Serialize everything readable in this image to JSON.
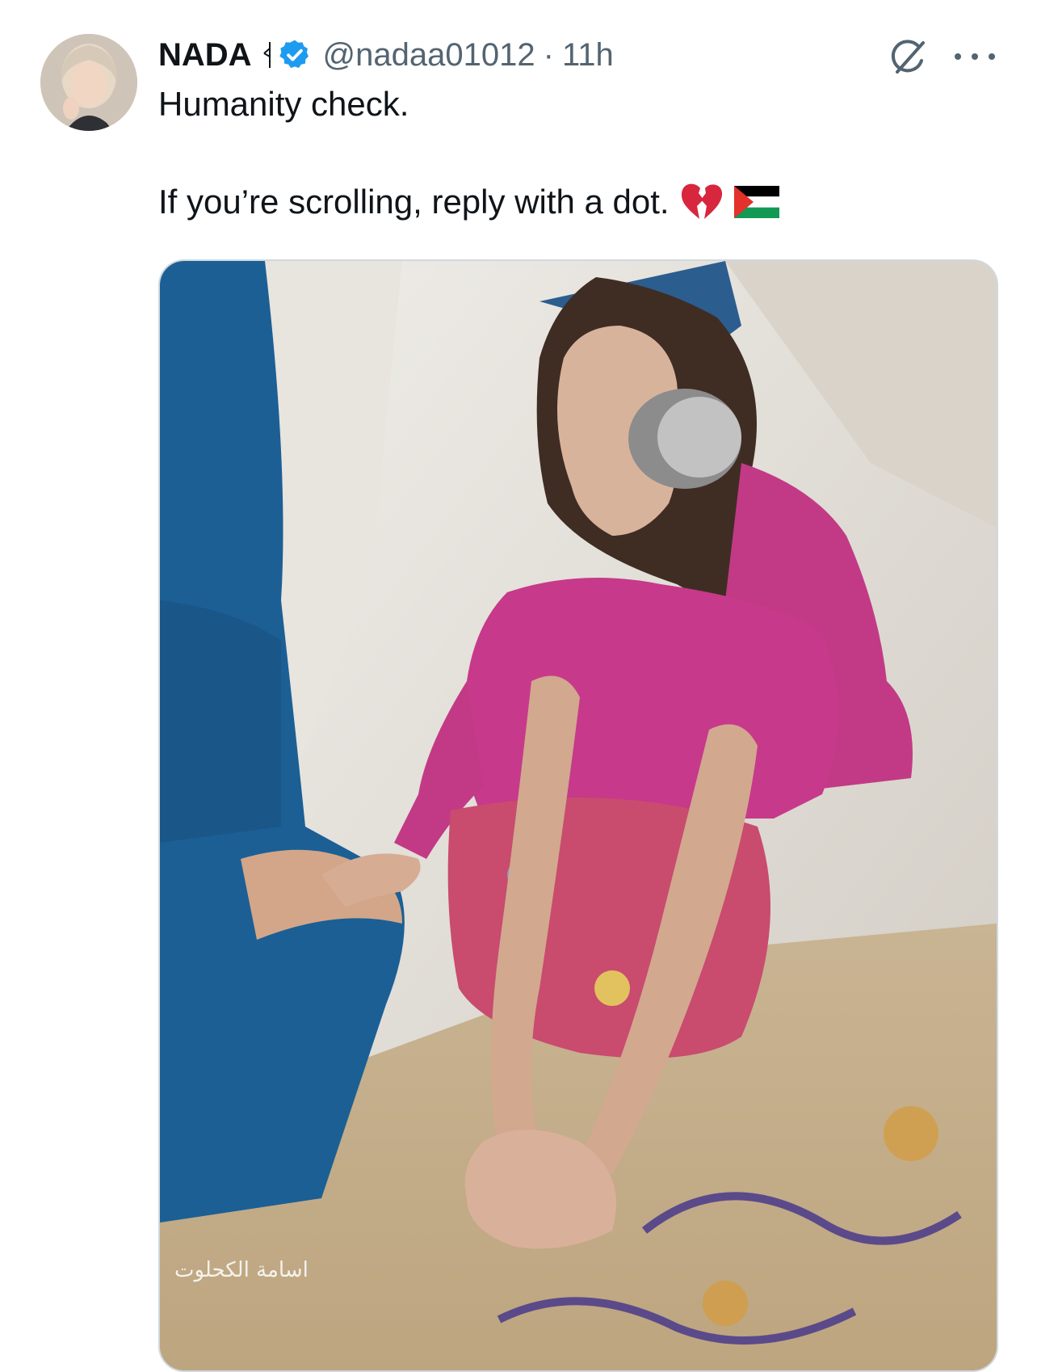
{
  "tweet": {
    "author_name": "NADA",
    "handle": "@nadaa01012",
    "separator": "·",
    "timestamp": "11h",
    "text_line1": "Humanity check.",
    "text_line2": "If you’re scrolling, reply with a dot.",
    "emojis": [
      "broken-heart-icon",
      "palestine-flag-icon"
    ]
  },
  "media": {
    "watermark": "اسامة الكحلوت"
  },
  "colors": {
    "text_primary": "#0f1419",
    "text_secondary": "#536471",
    "verified_blue": "#1d9bf0",
    "media_border": "#cfd9de"
  }
}
